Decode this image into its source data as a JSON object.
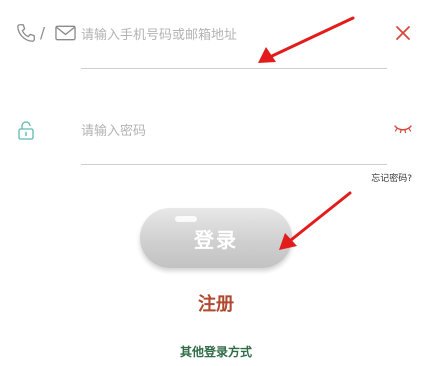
{
  "account": {
    "separator": "/",
    "placeholder": "请输入手机号码或邮箱地址",
    "value": ""
  },
  "password": {
    "placeholder": "请输入密码",
    "value": ""
  },
  "forgot_password": "忘记密码?",
  "login_button": "登录",
  "register_link": "注册",
  "other_login": "其他登录方式",
  "icons": {
    "phone": "phone-icon",
    "mail": "mail-icon",
    "clear": "close-icon",
    "lock": "lock-icon",
    "eye": "eye-closed-icon"
  },
  "colors": {
    "clear_icon": "#d9463a",
    "eye_icon": "#d9463a",
    "lock_icon": "#5fb9b0",
    "register": "#b0492f",
    "other_login": "#2f6b46",
    "annotation_arrow": "#e21b1b"
  }
}
